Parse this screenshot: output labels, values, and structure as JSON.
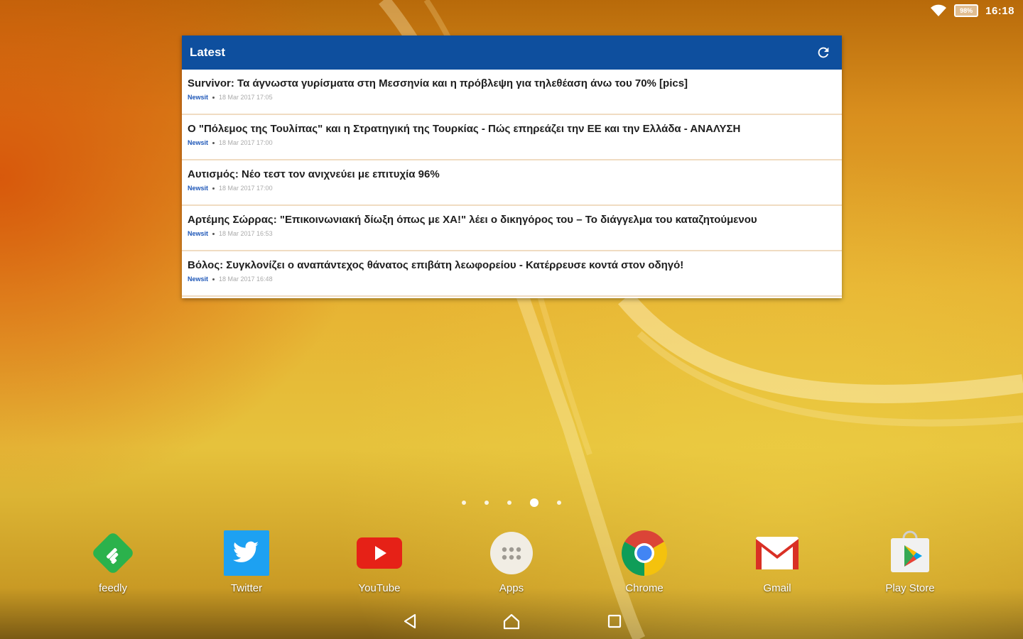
{
  "status_bar": {
    "battery_percent": 0.98,
    "battery_label": "98%",
    "time": "16:18",
    "icons": [
      "wifi-icon",
      "battery-icon"
    ]
  },
  "widget": {
    "title": "Latest",
    "header_color": "#0e4f9e",
    "refresh_icon": "refresh-icon",
    "items": [
      {
        "title": "Survivor: Τα άγνωστα γυρίσματα στη Μεσσηνία και η πρόβλεψη για τηλεθέαση άνω του 70% [pics]",
        "source": "Newsit",
        "time": "18 Mar 2017 17:05"
      },
      {
        "title": "Ο \"Πόλεμος της Τουλίπας\" και η Στρατηγική της Τουρκίας - Πώς επηρεάζει την ΕΕ και την Ελλάδα - ΑΝΑΛΥΣΗ",
        "source": "Newsit",
        "time": "18 Mar 2017 17:00"
      },
      {
        "title": "Αυτισμός: Νέο τεστ τον ανιχνεύει με επιτυχία 96%",
        "source": "Newsit",
        "time": "18 Mar 2017 17:00"
      },
      {
        "title": "Αρτέμης Σώρρας: \"Επικοινωνιακή δίωξη όπως με ΧΑ!\" λέει ο δικηγόρος του – Το διάγγελμα του καταζητούμενου",
        "source": "Newsit",
        "time": "18 Mar 2017 16:53"
      },
      {
        "title": "Βόλος: Συγκλονίζει ο αναπάντεχος θάνατος επιβάτη λεωφορείου - Κατέρρευσε κοντά στον οδηγό!",
        "source": "Newsit",
        "time": "18 Mar 2017 16:48"
      }
    ]
  },
  "page_indicator": {
    "count": 5,
    "active_index": 3
  },
  "dock": {
    "apps": [
      {
        "label": "feedly",
        "icon": "feedly-icon"
      },
      {
        "label": "Twitter",
        "icon": "twitter-icon"
      },
      {
        "label": "YouTube",
        "icon": "youtube-icon"
      },
      {
        "label": "Apps",
        "icon": "apps-drawer-icon"
      },
      {
        "label": "Chrome",
        "icon": "chrome-icon"
      },
      {
        "label": "Gmail",
        "icon": "gmail-icon"
      },
      {
        "label": "Play Store",
        "icon": "play-store-icon"
      }
    ]
  },
  "nav_bar": {
    "buttons": [
      "back-icon",
      "home-icon",
      "recents-icon"
    ]
  }
}
